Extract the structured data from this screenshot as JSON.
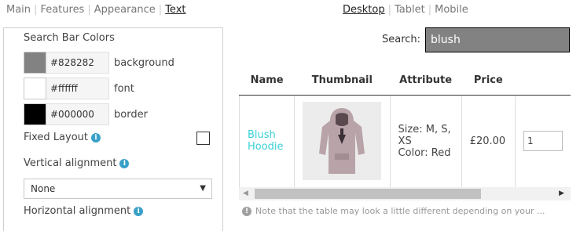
{
  "tabs_left": [
    {
      "label": "Main",
      "active": false
    },
    {
      "label": "Features",
      "active": false
    },
    {
      "label": "Appearance",
      "active": false
    },
    {
      "label": "Text",
      "active": true
    }
  ],
  "tabs_right": [
    {
      "label": "Desktop",
      "active": true
    },
    {
      "label": "Tablet",
      "active": false
    },
    {
      "label": "Mobile",
      "active": false
    }
  ],
  "settings": {
    "section_title": "Search Bar Colors",
    "colors": [
      {
        "hex": "#828282",
        "label": "background",
        "swatch": "#828282"
      },
      {
        "hex": "#ffffff",
        "label": "font",
        "swatch": "#ffffff"
      },
      {
        "hex": "#000000",
        "label": "border",
        "swatch": "#000000"
      }
    ],
    "fixed_layout_label": "Fixed Layout",
    "fixed_layout_checked": false,
    "vertical_alignment_label": "Vertical alignment",
    "vertical_alignment_value": "None",
    "horizontal_alignment_label": "Horizontal alignment"
  },
  "preview": {
    "search_label": "Search:",
    "search_value": "blush",
    "columns": [
      "Name",
      "Thumbnail",
      "Attribute",
      "Price"
    ],
    "row": {
      "name": "Blush Hoodie",
      "attribute_sizes": "Size: M, S, XS",
      "attribute_color": "Color: Red",
      "price": "£20.00",
      "qty": "1"
    },
    "note": "Note that the table may look a little different depending on your ..."
  }
}
